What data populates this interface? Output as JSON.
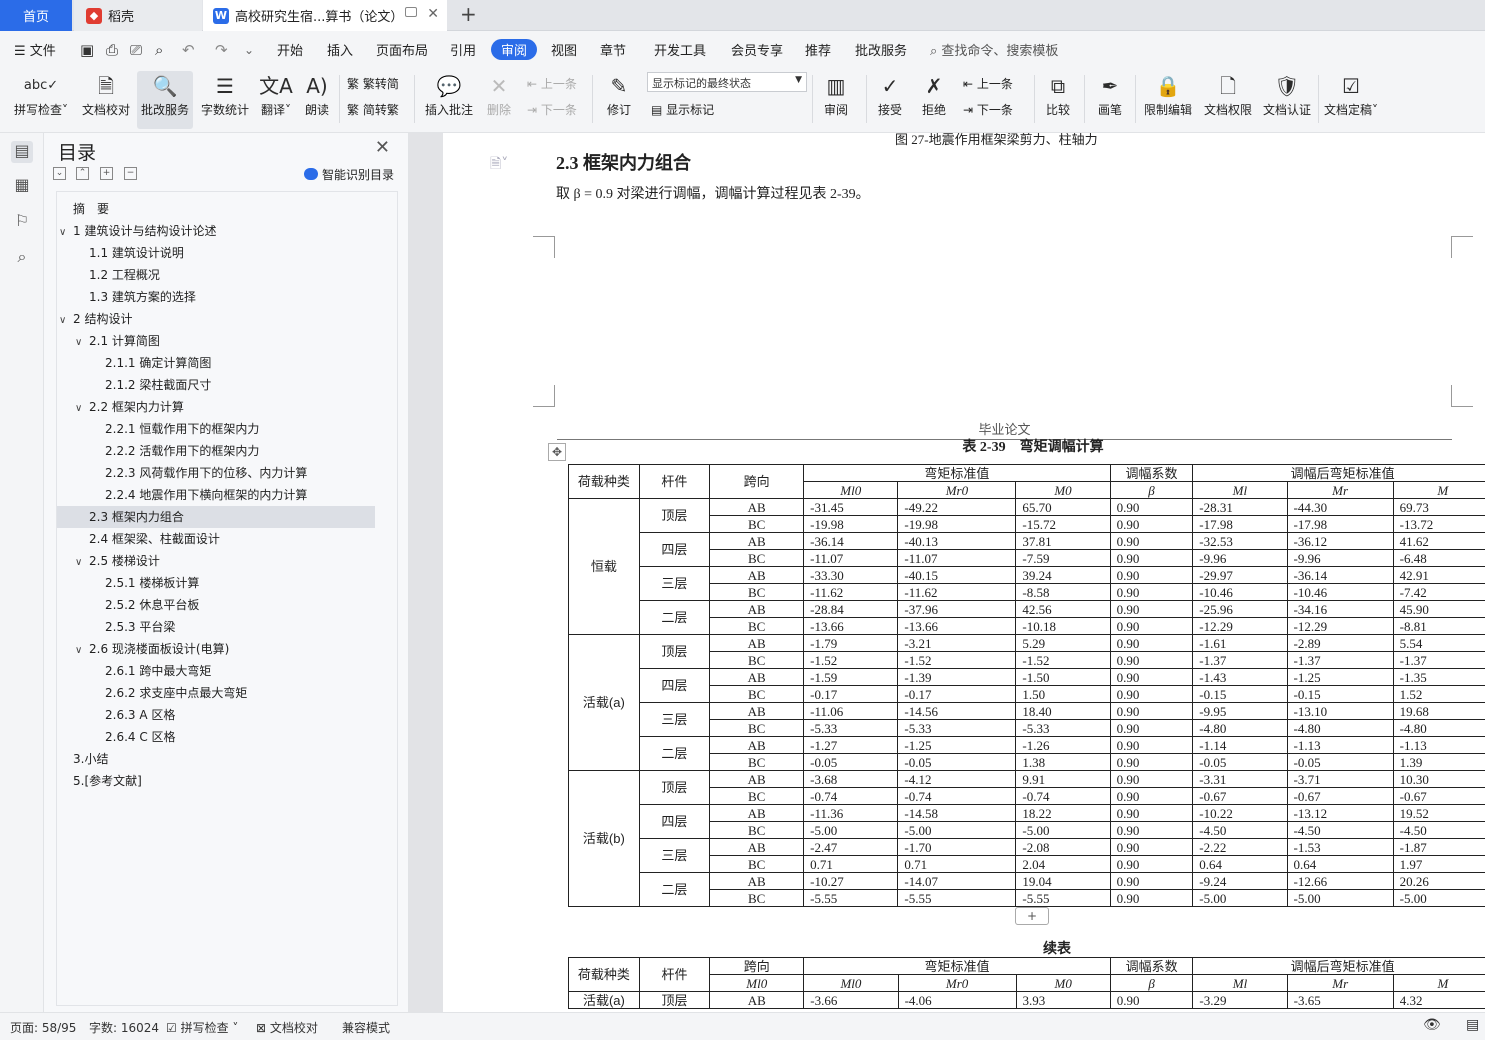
{
  "tabs": {
    "home": "首页",
    "daoke": "稻壳",
    "doc": "高校研究生宿...算书（论文）"
  },
  "menu": {
    "file": "文件",
    "items": [
      "开始",
      "插入",
      "页面布局",
      "引用",
      "审阅",
      "视图",
      "章节",
      "开发工具",
      "会员专享",
      "推荐",
      "批改服务"
    ],
    "search": "查找命令、搜索模板"
  },
  "ribbon": {
    "spell": "拼写检查",
    "proof": "文档校对",
    "revise": "批改服务",
    "count": "字数统计",
    "translate": "翻译",
    "read": "朗读",
    "s2t": "繁转简",
    "t2s": "简转繁",
    "insert_comment": "插入批注",
    "delete": "删除",
    "prev": "上一条",
    "next": "下一条",
    "track": "修订",
    "mark_state": "显示标记的最终状态",
    "show_marks": "显示标记",
    "review": "审阅",
    "accept": "接受",
    "reject": "拒绝",
    "prev2": "上一条",
    "next2": "下一条",
    "compare": "比较",
    "ink": "画笔",
    "restrict": "限制编辑",
    "perm": "文档权限",
    "cert": "文档认证",
    "final": "文档定稿"
  },
  "toc": {
    "title": "目录",
    "smart": "智能识别目录",
    "items": [
      {
        "label": "摘　要",
        "level": 0,
        "caret": ""
      },
      {
        "label": "1 建筑设计与结构设计论述",
        "level": 0,
        "caret": "v"
      },
      {
        "label": "1.1 建筑设计说明",
        "level": 1,
        "caret": ""
      },
      {
        "label": "1.2 工程概况",
        "level": 1,
        "caret": ""
      },
      {
        "label": "1.3 建筑方案的选择",
        "level": 1,
        "caret": ""
      },
      {
        "label": "2 结构设计",
        "level": 0,
        "caret": "v"
      },
      {
        "label": "2.1 计算简图",
        "level": 1,
        "caret": "v"
      },
      {
        "label": "2.1.1 确定计算简图",
        "level": 2,
        "caret": ""
      },
      {
        "label": "2.1.2 梁柱截面尺寸",
        "level": 2,
        "caret": ""
      },
      {
        "label": "2.2 框架内力计算",
        "level": 1,
        "caret": "v"
      },
      {
        "label": "2.2.1 恒载作用下的框架内力",
        "level": 2,
        "caret": ""
      },
      {
        "label": "2.2.2 活载作用下的框架内力",
        "level": 2,
        "caret": ""
      },
      {
        "label": "2.2.3 风荷载作用下的位移、内力计算",
        "level": 2,
        "caret": ""
      },
      {
        "label": "2.2.4 地震作用下横向框架的内力计算",
        "level": 2,
        "caret": ""
      },
      {
        "label": "2.3 框架内力组合",
        "level": 1,
        "caret": "",
        "selected": true
      },
      {
        "label": "2.4 框架梁、柱截面设计",
        "level": 1,
        "caret": ""
      },
      {
        "label": "2.5 楼梯设计",
        "level": 1,
        "caret": "v"
      },
      {
        "label": "2.5.1 楼梯板计算",
        "level": 2,
        "caret": ""
      },
      {
        "label": "2.5.2 休息平台板",
        "level": 2,
        "caret": ""
      },
      {
        "label": "2.5.3 平台梁",
        "level": 2,
        "caret": ""
      },
      {
        "label": "2.6 现浇楼面板设计(电算)",
        "level": 1,
        "caret": "v"
      },
      {
        "label": "2.6.1 跨中最大弯矩",
        "level": 2,
        "caret": ""
      },
      {
        "label": "2.6.2 求支座中点最大弯矩",
        "level": 2,
        "caret": ""
      },
      {
        "label": "2.6.3 A 区格",
        "level": 2,
        "caret": ""
      },
      {
        "label": "2.6.4 C 区格",
        "level": 2,
        "caret": ""
      },
      {
        "label": "3.小结",
        "level": 0,
        "caret": ""
      },
      {
        "label": "5.[参考文献]",
        "level": 0,
        "caret": ""
      }
    ]
  },
  "doc": {
    "p1_caption": "图 27-地震作用框架梁剪力、柱轴力",
    "p1_heading": "2.3 框架内力组合",
    "p1_text": "取 β = 0.9 对梁进行调幅，调幅计算过程见表 2-39。",
    "header": "毕业论文",
    "table_caption": "表 2-39　弯矩调幅计算",
    "cont_caption": "续表",
    "headers": {
      "load": "荷载种类",
      "member": "杆件",
      "span": "跨向",
      "std": "弯矩标准值",
      "coef": "调幅系数",
      "after": "调幅后弯矩标准值",
      "sub": [
        "M l0",
        "M r0",
        "M 0",
        "β",
        "M l",
        "M r",
        "M"
      ]
    },
    "groups": [
      {
        "load": "恒载",
        "floors": [
          {
            "name": "顶层",
            "rows": [
              [
                "AB",
                "-31.45",
                "-49.22",
                "65.70",
                "0.90",
                "-28.31",
                "-44.30",
                "69.73"
              ],
              [
                "BC",
                "-19.98",
                "-19.98",
                "-15.72",
                "0.90",
                "-17.98",
                "-17.98",
                "-13.72"
              ]
            ]
          },
          {
            "name": "四层",
            "rows": [
              [
                "AB",
                "-36.14",
                "-40.13",
                "37.81",
                "0.90",
                "-32.53",
                "-36.12",
                "41.62"
              ],
              [
                "BC",
                "-11.07",
                "-11.07",
                "-7.59",
                "0.90",
                "-9.96",
                "-9.96",
                "-6.48"
              ]
            ]
          },
          {
            "name": "三层",
            "rows": [
              [
                "AB",
                "-33.30",
                "-40.15",
                "39.24",
                "0.90",
                "-29.97",
                "-36.14",
                "42.91"
              ],
              [
                "BC",
                "-11.62",
                "-11.62",
                "-8.58",
                "0.90",
                "-10.46",
                "-10.46",
                "-7.42"
              ]
            ]
          },
          {
            "name": "二层",
            "rows": [
              [
                "AB",
                "-28.84",
                "-37.96",
                "42.56",
                "0.90",
                "-25.96",
                "-34.16",
                "45.90"
              ],
              [
                "BC",
                "-13.66",
                "-13.66",
                "-10.18",
                "0.90",
                "-12.29",
                "-12.29",
                "-8.81"
              ]
            ]
          }
        ]
      },
      {
        "load": "活载(a)",
        "floors": [
          {
            "name": "顶层",
            "rows": [
              [
                "AB",
                "-1.79",
                "-3.21",
                "5.29",
                "0.90",
                "-1.61",
                "-2.89",
                "5.54"
              ],
              [
                "BC",
                "-1.52",
                "-1.52",
                "-1.52",
                "0.90",
                "-1.37",
                "-1.37",
                "-1.37"
              ]
            ]
          },
          {
            "name": "四层",
            "rows": [
              [
                "AB",
                "-1.59",
                "-1.39",
                "-1.50",
                "0.90",
                "-1.43",
                "-1.25",
                "-1.35"
              ],
              [
                "BC",
                "-0.17",
                "-0.17",
                "1.50",
                "0.90",
                "-0.15",
                "-0.15",
                "1.52"
              ]
            ]
          },
          {
            "name": "三层",
            "rows": [
              [
                "AB",
                "-11.06",
                "-14.56",
                "18.40",
                "0.90",
                "-9.95",
                "-13.10",
                "19.68"
              ],
              [
                "BC",
                "-5.33",
                "-5.33",
                "-5.33",
                "0.90",
                "-4.80",
                "-4.80",
                "-4.80"
              ]
            ]
          },
          {
            "name": "二层",
            "rows": [
              [
                "AB",
                "-1.27",
                "-1.25",
                "-1.26",
                "0.90",
                "-1.14",
                "-1.13",
                "-1.13"
              ],
              [
                "BC",
                "-0.05",
                "-0.05",
                "1.38",
                "0.90",
                "-0.05",
                "-0.05",
                "1.39"
              ]
            ]
          }
        ]
      },
      {
        "load": "活载(b)",
        "floors": [
          {
            "name": "顶层",
            "rows": [
              [
                "AB",
                "-3.68",
                "-4.12",
                "9.91",
                "0.90",
                "-3.31",
                "-3.71",
                "10.30"
              ],
              [
                "BC",
                "-0.74",
                "-0.74",
                "-0.74",
                "0.90",
                "-0.67",
                "-0.67",
                "-0.67"
              ]
            ]
          },
          {
            "name": "四层",
            "rows": [
              [
                "AB",
                "-11.36",
                "-14.58",
                "18.22",
                "0.90",
                "-10.22",
                "-13.12",
                "19.52"
              ],
              [
                "BC",
                "-5.00",
                "-5.00",
                "-5.00",
                "0.90",
                "-4.50",
                "-4.50",
                "-4.50"
              ]
            ]
          },
          {
            "name": "三层",
            "rows": [
              [
                "AB",
                "-2.47",
                "-1.70",
                "-2.08",
                "0.90",
                "-2.22",
                "-1.53",
                "-1.87"
              ],
              [
                "BC",
                "0.71",
                "0.71",
                "2.04",
                "0.90",
                "0.64",
                "0.64",
                "1.97"
              ]
            ]
          },
          {
            "name": "二层",
            "rows": [
              [
                "AB",
                "-10.27",
                "-14.07",
                "19.04",
                "0.90",
                "-9.24",
                "-12.66",
                "20.26"
              ],
              [
                "BC",
                "-5.55",
                "-5.55",
                "-5.55",
                "0.90",
                "-5.00",
                "-5.00",
                "-5.00"
              ]
            ]
          }
        ]
      }
    ],
    "cont_first": {
      "load": "活载(a)",
      "floor": "顶层",
      "row": [
        "AB",
        "-3.66",
        "-4.06",
        "3.93",
        "0.90",
        "-3.29",
        "-3.65",
        "4.32"
      ]
    }
  },
  "status": {
    "page": "页面: 58/95",
    "words": "字数: 16024",
    "spell": "拼写检查",
    "proof": "文档校对",
    "compat": "兼容模式"
  }
}
